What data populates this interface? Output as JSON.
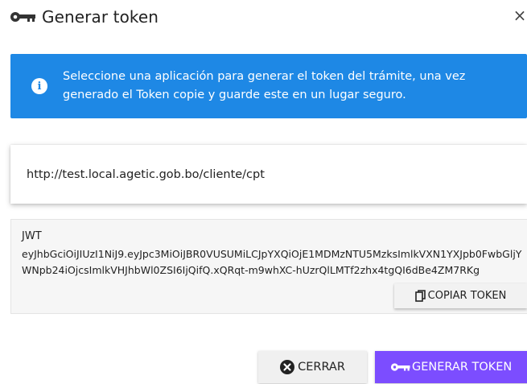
{
  "dialog": {
    "title": "Generar token",
    "title_icon": "key-icon",
    "close_icon": "close-icon",
    "close_glyph": "×"
  },
  "alert": {
    "icon": "info-icon",
    "icon_glyph": "i",
    "text": "Seleccione una aplicación para generar el token del trámite, una vez generado el Token copie y guarde este en un lugar seguro.",
    "color": "#1e88e5"
  },
  "application_select": {
    "value": "http://test.local.agetic.gob.bo/cliente/cpt"
  },
  "token": {
    "label": "JWT",
    "value": "eyJhbGciOiJIUzI1NiJ9.eyJpc3MiOiJBR0VUSUMiLCJpYXQiOjE1MDMzNTU5MzksImlkVXN1YXJpb0FwbGljYWNpb24iOjcsImlkVHJhbWl0ZSI6IjQifQ.xQRqt-m9whXC-hUzrQlLMTf2zhx4tgQI6dBe4ZM7RKg",
    "copy_button_label": "COPIAR TOKEN",
    "copy_icon": "copy-icon"
  },
  "footer": {
    "close_label": "CERRAR",
    "close_icon": "x-circle-icon",
    "generate_label": "GENERAR TOKEN",
    "generate_icon": "key-icon",
    "generate_color": "#7c4dff"
  }
}
